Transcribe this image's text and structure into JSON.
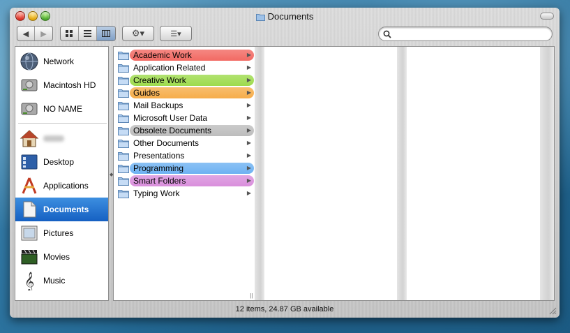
{
  "window": {
    "title": "Documents"
  },
  "toolbar": {
    "back": "◀",
    "forward": "▶",
    "view_icon": "icon-view",
    "view_list": "list-view",
    "view_column": "column-view",
    "action": "⚙▾",
    "arrange": "☰▾",
    "search_value": ""
  },
  "sidebar": {
    "devices": [
      {
        "label": "Network",
        "icon": "network-globe-icon"
      },
      {
        "label": "Macintosh HD",
        "icon": "hard-drive-icon"
      },
      {
        "label": "NO NAME",
        "icon": "hard-drive-icon"
      }
    ],
    "places": [
      {
        "label": "",
        "icon": "home-icon"
      },
      {
        "label": "Desktop",
        "icon": "desktop-icon"
      },
      {
        "label": "Applications",
        "icon": "applications-icon"
      },
      {
        "label": "Documents",
        "icon": "documents-icon",
        "selected": true
      },
      {
        "label": "Pictures",
        "icon": "pictures-icon"
      },
      {
        "label": "Movies",
        "icon": "movies-icon"
      },
      {
        "label": "Music",
        "icon": "music-icon"
      }
    ]
  },
  "column1": [
    {
      "label": "Academic Work",
      "color": "#f26a63"
    },
    {
      "label": "Application Related",
      "color": ""
    },
    {
      "label": "Creative Work",
      "color": "#9edb4d"
    },
    {
      "label": "Guides",
      "color": "#f6ad4a"
    },
    {
      "label": "Mail Backups",
      "color": ""
    },
    {
      "label": "Microsoft User Data",
      "color": ""
    },
    {
      "label": "Obsolete Documents",
      "color": "#bdbdbd"
    },
    {
      "label": "Other Documents",
      "color": ""
    },
    {
      "label": "Presentations",
      "color": ""
    },
    {
      "label": "Programming",
      "color": "#6eb2f2"
    },
    {
      "label": "Smart Folders",
      "color": "#d98fdc"
    },
    {
      "label": "Typing Work",
      "color": ""
    }
  ],
  "status": {
    "text": "12 items, 24.87 GB available"
  }
}
